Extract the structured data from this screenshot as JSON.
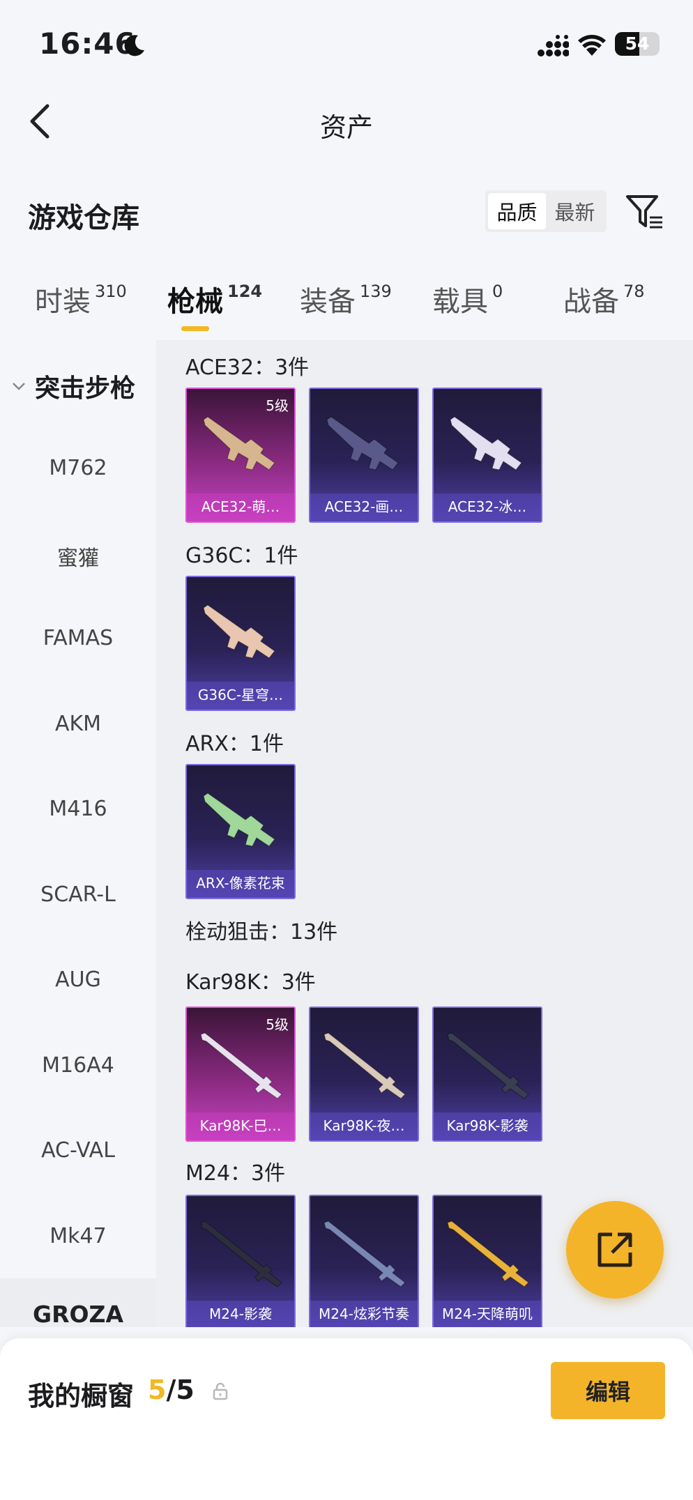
{
  "status_bar": {
    "time": "16:46",
    "battery": "54"
  },
  "nav": {
    "title": "资产"
  },
  "section": {
    "title": "游戏仓库",
    "sort_quality": "品质",
    "sort_latest": "最新"
  },
  "tabs": [
    {
      "label": "时装",
      "count": "310"
    },
    {
      "label": "枪械",
      "count": "124"
    },
    {
      "label": "装备",
      "count": "139"
    },
    {
      "label": "载具",
      "count": "0"
    },
    {
      "label": "战备",
      "count": "78"
    }
  ],
  "sidebar": {
    "category": "突击步枪",
    "items": [
      "M762",
      "蜜獾",
      "FAMAS",
      "AKM",
      "M416",
      "SCAR-L",
      "AUG",
      "M16A4",
      "AC-VAL",
      "Mk47"
    ],
    "cut_item": "GROZA"
  },
  "content": {
    "groups": [
      {
        "label": "ACE32：3件",
        "cards": [
          {
            "name": "ACE32-萌…",
            "tier": "5级",
            "color": "#d7b58e"
          },
          {
            "name": "ACE32-画…",
            "color": "#5a5a8a"
          },
          {
            "name": "ACE32-冰…",
            "color": "#e4dff0"
          }
        ]
      },
      {
        "label": "G36C：1件",
        "cards": [
          {
            "name": "G36C-星穹…",
            "color": "#e8c6b0"
          }
        ]
      },
      {
        "label": "ARX：1件",
        "cards": [
          {
            "name": "ARX-像素花束",
            "color": "#9fd89a"
          }
        ]
      },
      {
        "label": "栓动狙击：13件"
      },
      {
        "label": "Kar98K：3件",
        "cards": [
          {
            "name": "Kar98K-巳…",
            "tier": "5级",
            "color": "#e8e2ee"
          },
          {
            "name": "Kar98K-夜…",
            "color": "#d9c9b8"
          },
          {
            "name": "Kar98K-影袭",
            "color": "#3a3e52"
          }
        ]
      },
      {
        "label": "M24：3件",
        "cards": [
          {
            "name": "M24-影袭",
            "color": "#2c2e3e"
          },
          {
            "name": "M24-炫彩节奏",
            "color": "#7a86b4"
          },
          {
            "name": "M24-天降萌叽",
            "color": "#e8b23a"
          }
        ]
      }
    ]
  },
  "bottom": {
    "label": "我的橱窗",
    "current": "5",
    "total": "/5",
    "edit": "编辑"
  },
  "colors": {
    "accent": "#f4b42a",
    "tab_underline": "#f2b822"
  }
}
